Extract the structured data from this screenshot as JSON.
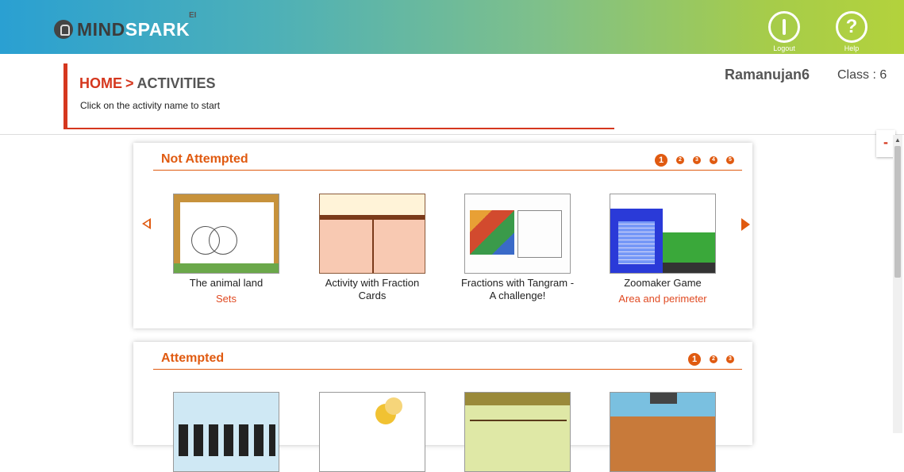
{
  "header": {
    "brand_mind": "MIND",
    "brand_spark": "SPARK",
    "brand_ei": "EI",
    "logout_label": "Logout",
    "help_label": "Help",
    "help_glyph": "?"
  },
  "breadcrumb": {
    "home": "HOME",
    "separator": ">",
    "current": "ACTIVITIES"
  },
  "instruction": "Click on the activity name to start",
  "user": {
    "name": "Ramanujan6",
    "class_label": "Class : 6"
  },
  "collapse_label": "-",
  "sections": [
    {
      "title": "Not Attempted",
      "pages": [
        "1",
        "2",
        "3",
        "4",
        "5"
      ],
      "active_page": "1",
      "activities": [
        {
          "name": "The animal land",
          "topic": "Sets"
        },
        {
          "name": "Activity with Fraction Cards",
          "topic": ""
        },
        {
          "name": "Fractions with Tangram - A challenge!",
          "topic": ""
        },
        {
          "name": "Zoomaker Game",
          "topic": "Area and perimeter"
        }
      ]
    },
    {
      "title": "Attempted",
      "pages": [
        "1",
        "2",
        "3"
      ],
      "active_page": "1",
      "activities": [
        {
          "name": "",
          "topic": ""
        },
        {
          "name": "",
          "topic": ""
        },
        {
          "name": "",
          "topic": ""
        },
        {
          "name": "",
          "topic": ""
        }
      ]
    }
  ],
  "colors": {
    "accent": "#e05a10",
    "breadcrumb_red": "#d5371e",
    "header_start": "#2aa0d2",
    "header_end": "#b3d23c"
  }
}
